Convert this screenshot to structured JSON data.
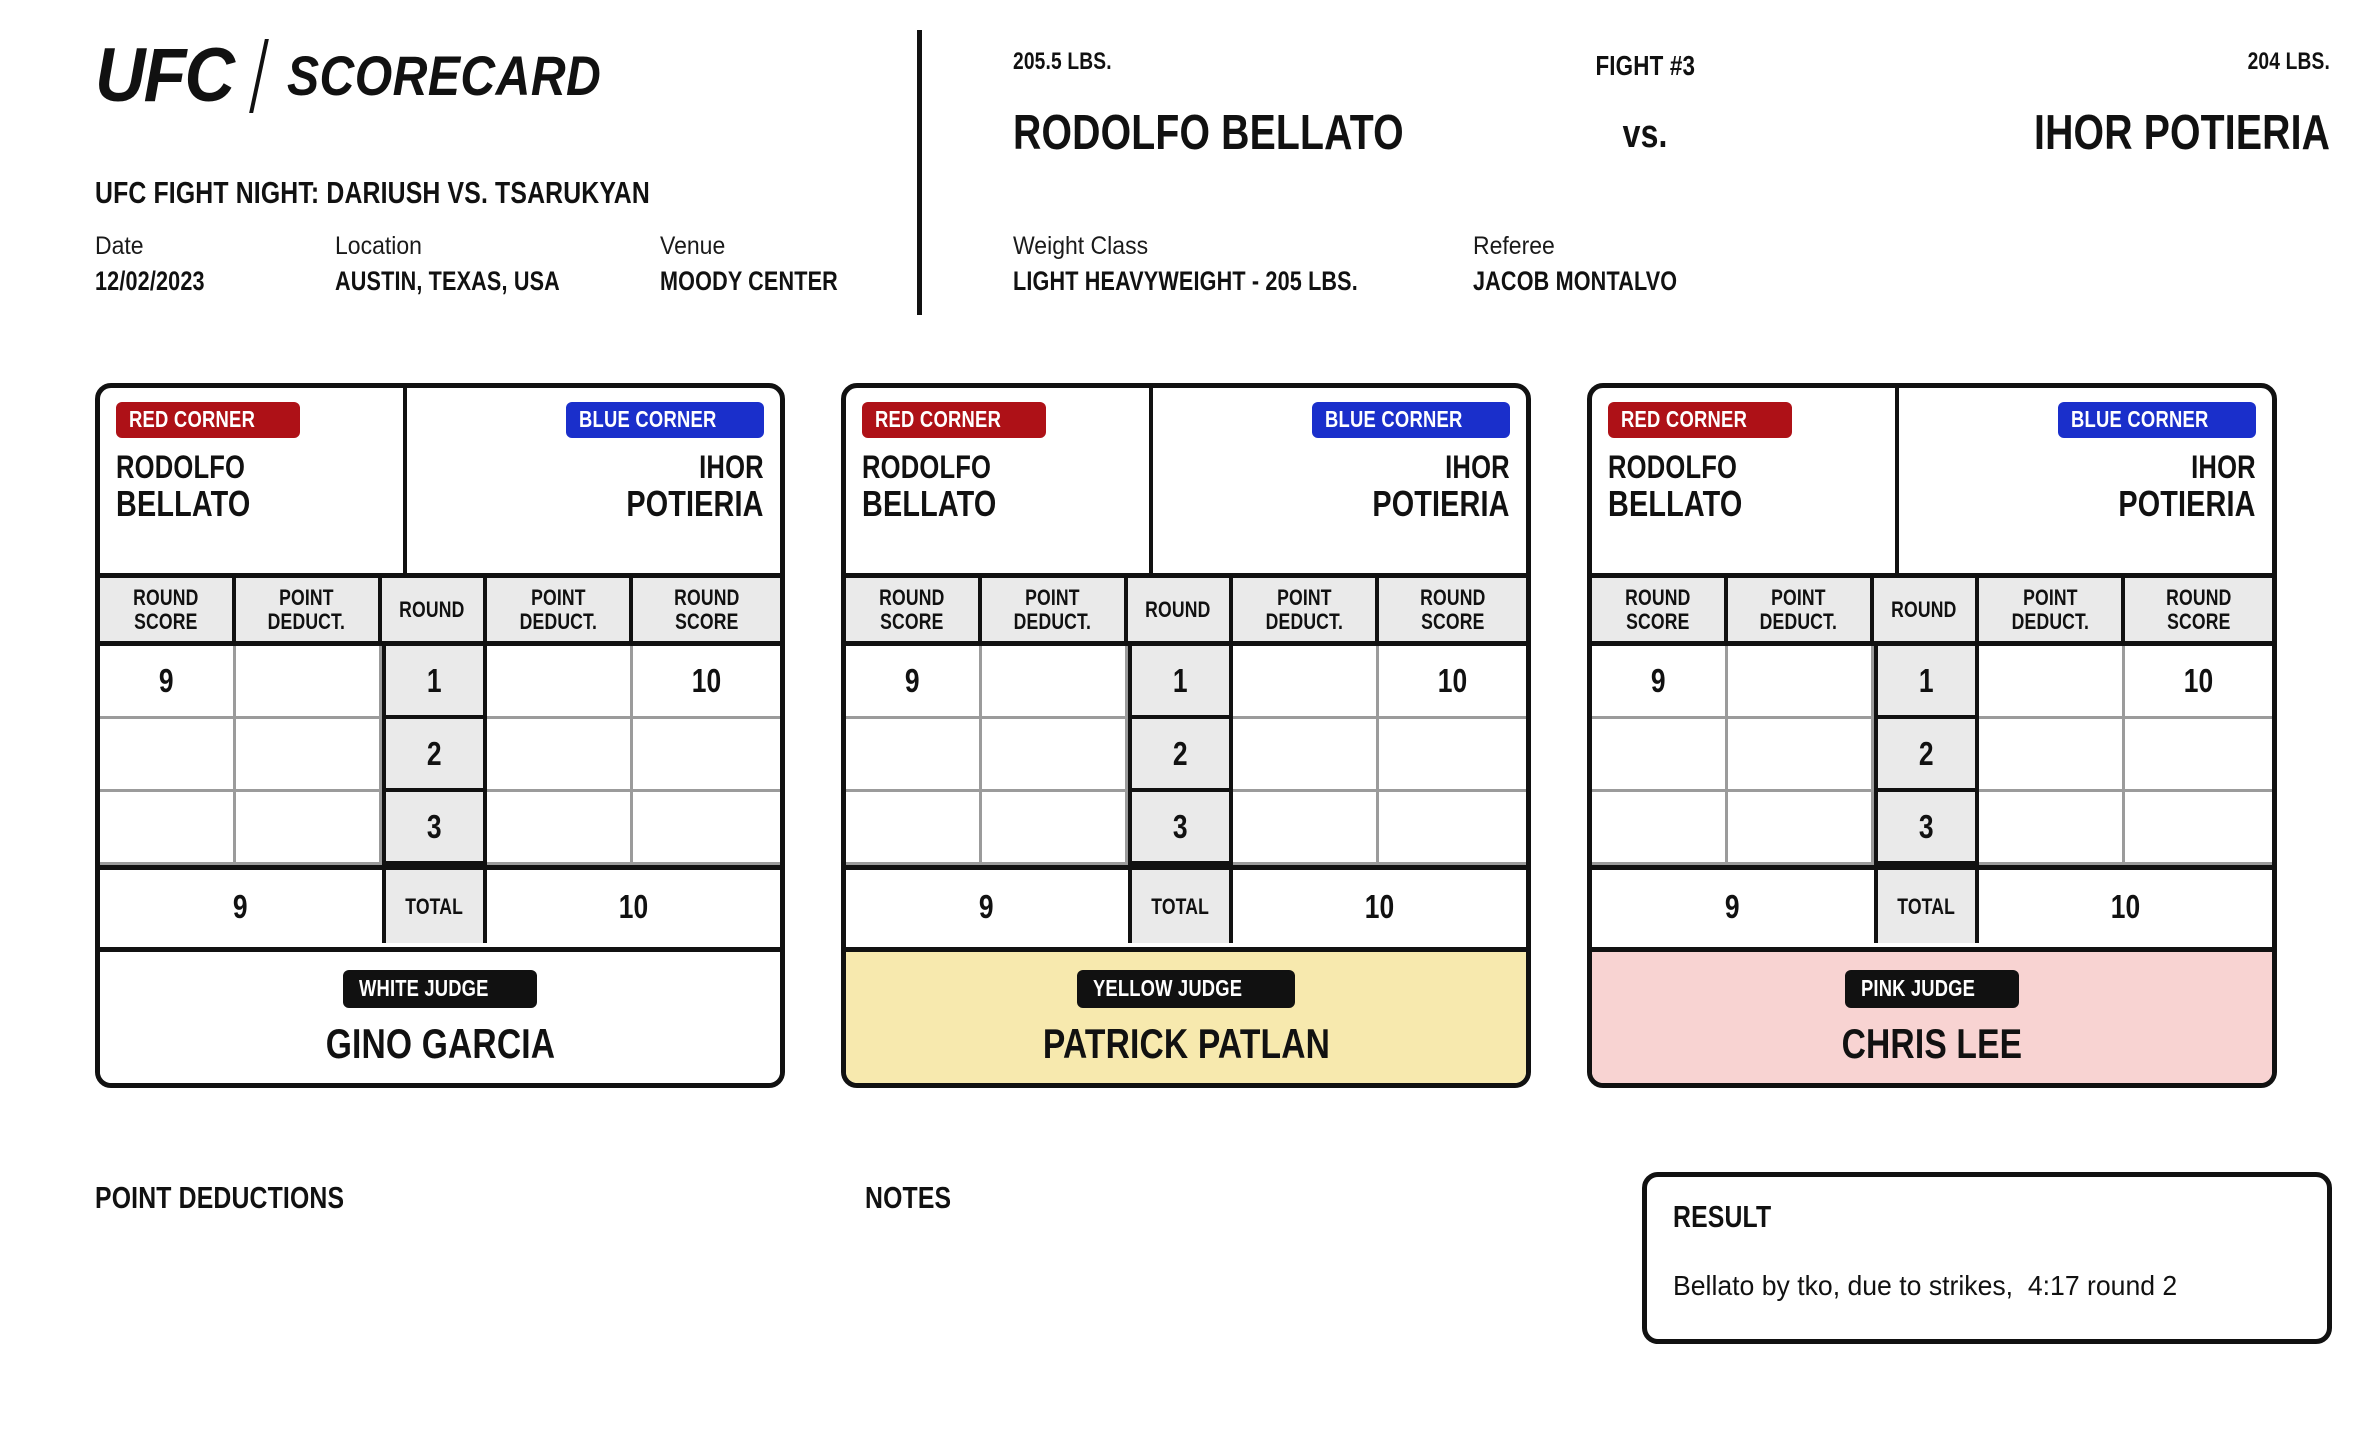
{
  "brand": {
    "logo_ufc": "UFC",
    "logo_word": "SCORECARD"
  },
  "event": {
    "title": "UFC FIGHT NIGHT: DARIUSH VS. TSARUKYAN",
    "date_label": "Date",
    "date_value": "12/02/2023",
    "location_label": "Location",
    "location_value": "AUSTIN, TEXAS, USA",
    "venue_label": "Venue",
    "venue_value": "MOODY CENTER"
  },
  "bout": {
    "fight_number": "FIGHT #3",
    "vs": "vs.",
    "red_weight": "205.5 LBS.",
    "blue_weight": "204 LBS.",
    "red_name": "RODOLFO BELLATO",
    "blue_name": "IHOR POTIERIA",
    "weight_class_label": "Weight Class",
    "weight_class_value": "LIGHT HEAVYWEIGHT - 205 LBS.",
    "referee_label": "Referee",
    "referee_value": "JACOB MONTALVO"
  },
  "fighters": {
    "red": {
      "corner_label": "RED CORNER",
      "first": "RODOLFO",
      "last": "BELLATO",
      "corner_color": "#AE1117"
    },
    "blue": {
      "corner_label": "BLUE CORNER",
      "first": "IHOR",
      "last": "POTIERIA",
      "corner_color": "#1A2FCB"
    }
  },
  "table_headers": {
    "round_score_a": "ROUND\nSCORE",
    "round_score_line1": "ROUND",
    "round_score_line2": "SCORE",
    "point_deduct_line1": "POINT",
    "point_deduct_line2": "DEDUCT.",
    "round": "ROUND",
    "total": "TOTAL"
  },
  "scorecards": [
    {
      "judge_badge": "WHITE JUDGE",
      "judge_name": "GINO GARCIA",
      "theme": "white",
      "theme_color": "#FFFFFF",
      "rows": [
        {
          "round": "1",
          "red_score": "9",
          "red_deduct": "",
          "blue_deduct": "",
          "blue_score": "10"
        },
        {
          "round": "2",
          "red_score": "",
          "red_deduct": "",
          "blue_deduct": "",
          "blue_score": ""
        },
        {
          "round": "3",
          "red_score": "",
          "red_deduct": "",
          "blue_deduct": "",
          "blue_score": ""
        }
      ],
      "total_red": "9",
      "total_blue": "10"
    },
    {
      "judge_badge": "YELLOW JUDGE",
      "judge_name": "PATRICK PATLAN",
      "theme": "yellow",
      "theme_color": "#F7E9AE",
      "rows": [
        {
          "round": "1",
          "red_score": "9",
          "red_deduct": "",
          "blue_deduct": "",
          "blue_score": "10"
        },
        {
          "round": "2",
          "red_score": "",
          "red_deduct": "",
          "blue_deduct": "",
          "blue_score": ""
        },
        {
          "round": "3",
          "red_score": "",
          "red_deduct": "",
          "blue_deduct": "",
          "blue_score": ""
        }
      ],
      "total_red": "9",
      "total_blue": "10"
    },
    {
      "judge_badge": "PINK JUDGE",
      "judge_name": "CHRIS LEE",
      "theme": "pink",
      "theme_color": "#F8D3D2",
      "rows": [
        {
          "round": "1",
          "red_score": "9",
          "red_deduct": "",
          "blue_deduct": "",
          "blue_score": "10"
        },
        {
          "round": "2",
          "red_score": "",
          "red_deduct": "",
          "blue_deduct": "",
          "blue_score": ""
        },
        {
          "round": "3",
          "red_score": "",
          "red_deduct": "",
          "blue_deduct": "",
          "blue_score": ""
        }
      ],
      "total_red": "9",
      "total_blue": "10"
    }
  ],
  "footer": {
    "point_deductions_heading": "POINT DEDUCTIONS",
    "point_deductions_text": "",
    "notes_heading": "NOTES",
    "notes_text": "",
    "result_heading": "RESULT",
    "result_text": "Bellato by tko, due to strikes,  4:17 round 2"
  }
}
